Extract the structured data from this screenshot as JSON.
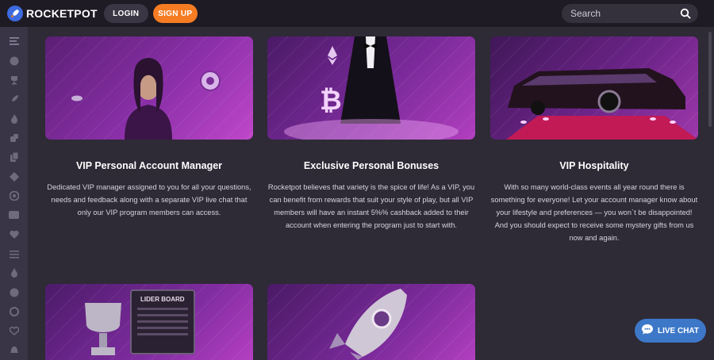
{
  "header": {
    "brand": "ROCKETPOT",
    "login_label": "LOGIN",
    "signup_label": "SIGN UP",
    "search_placeholder": "Search"
  },
  "sidebar": {
    "icons": [
      "menu-icon",
      "bitcoin-icon",
      "trophy-icon",
      "rocket-icon",
      "fire-icon",
      "dice-icon",
      "cards-icon",
      "chip-icon",
      "slots-icon",
      "live-icon",
      "heart-icon",
      "sliders-icon",
      "drop-icon",
      "ball-icon",
      "settings-icon",
      "heart-outline-icon",
      "bell-icon"
    ]
  },
  "cards": [
    {
      "title": "VIP Personal Account Manager",
      "text": "Dedicated VIP manager assigned to you for all your questions, needs and feedback along with a separate VIP live chat that only our VIP program members can access."
    },
    {
      "title": "Exclusive Personal Bonuses",
      "text": "Rocketpot believes that variety is the spice of life! As a VIP, you can benefit from rewards that suit your style of play, but all VIP members will have an instant 5%% cashback added to their account when entering the program just to start with."
    },
    {
      "title": "VIP Hospitality",
      "text": "With so many world-class events all year round there is something for everyone! Let your account manager know about your lifestyle and preferences — you won`t be disappointed! And you should expect to receive some mystery gifts from us now and again."
    }
  ],
  "bottom_cards": {
    "leaderboard_text": "LIDER BOARD"
  },
  "livechat_label": "LIVE CHAT",
  "colors": {
    "accent_orange": "#f57c22",
    "livechat_blue": "#3d78c8",
    "background": "#2e2a36"
  }
}
